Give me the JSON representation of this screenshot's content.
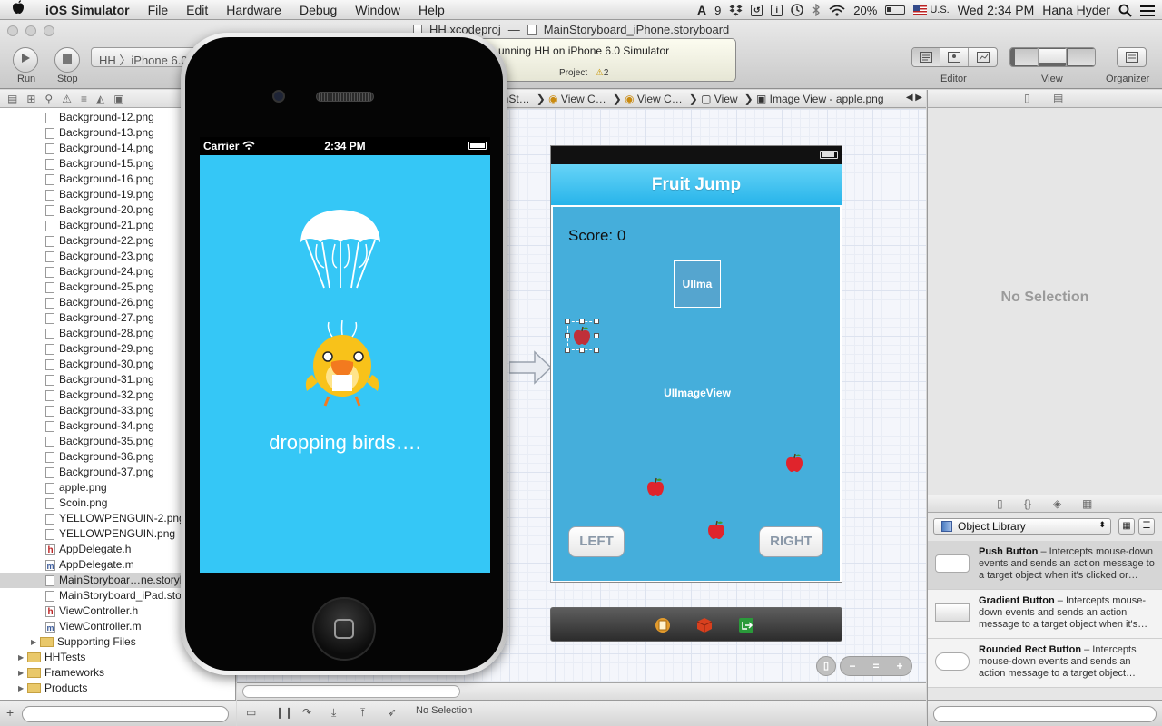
{
  "menubar": {
    "app_name": "iOS Simulator",
    "menus": [
      "File",
      "Edit",
      "Hardware",
      "Debug",
      "Window",
      "Help"
    ],
    "status": {
      "num_badge": "9",
      "battery": "20%",
      "input_source": "U.S.",
      "datetime": "Wed 2:34 PM",
      "user": "Hana Hyder"
    }
  },
  "toolbar": {
    "run_label": "Run",
    "stop_label": "Stop",
    "scheme": "HH 〉iPhone 6.0",
    "project_file": "HH.xcodeproj",
    "title_sep": "—",
    "storyboard_file": "MainStoryboard_iPhone.storyboard",
    "activity_status": "unning HH on iPhone 6.0 Simulator",
    "activity_project": "Project",
    "warning_count": "2",
    "editor_label": "Editor",
    "view_label": "View",
    "organizer_label": "Organizer"
  },
  "navigator": {
    "files": [
      {
        "name": "Background-12.png",
        "kind": "png"
      },
      {
        "name": "Background-13.png",
        "kind": "png"
      },
      {
        "name": "Background-14.png",
        "kind": "png"
      },
      {
        "name": "Background-15.png",
        "kind": "png"
      },
      {
        "name": "Background-16.png",
        "kind": "png"
      },
      {
        "name": "Background-19.png",
        "kind": "png"
      },
      {
        "name": "Background-20.png",
        "kind": "png"
      },
      {
        "name": "Background-21.png",
        "kind": "png"
      },
      {
        "name": "Background-22.png",
        "kind": "png"
      },
      {
        "name": "Background-23.png",
        "kind": "png"
      },
      {
        "name": "Background-24.png",
        "kind": "png"
      },
      {
        "name": "Background-25.png",
        "kind": "png"
      },
      {
        "name": "Background-26.png",
        "kind": "png"
      },
      {
        "name": "Background-27.png",
        "kind": "png"
      },
      {
        "name": "Background-28.png",
        "kind": "png"
      },
      {
        "name": "Background-29.png",
        "kind": "png"
      },
      {
        "name": "Background-30.png",
        "kind": "png"
      },
      {
        "name": "Background-31.png",
        "kind": "png"
      },
      {
        "name": "Background-32.png",
        "kind": "png"
      },
      {
        "name": "Background-33.png",
        "kind": "png"
      },
      {
        "name": "Background-34.png",
        "kind": "png"
      },
      {
        "name": "Background-35.png",
        "kind": "png"
      },
      {
        "name": "Background-36.png",
        "kind": "png"
      },
      {
        "name": "Background-37.png",
        "kind": "png"
      },
      {
        "name": "apple.png",
        "kind": "png"
      },
      {
        "name": "Scoin.png",
        "kind": "png"
      },
      {
        "name": "YELLOWPENGUIN-2.png",
        "kind": "png"
      },
      {
        "name": "YELLOWPENGUIN.png",
        "kind": "png"
      },
      {
        "name": "AppDelegate.h",
        "kind": "h"
      },
      {
        "name": "AppDelegate.m",
        "kind": "m"
      },
      {
        "name": "MainStoryboar…ne.storyb",
        "kind": "sb",
        "selected": true
      },
      {
        "name": "MainStoryboard_iPad.stor",
        "kind": "sb"
      },
      {
        "name": "ViewController.h",
        "kind": "h"
      },
      {
        "name": "ViewController.m",
        "kind": "m"
      }
    ],
    "supporting_files": "Supporting Files",
    "groups": [
      "HHTests",
      "Frameworks",
      "Products"
    ]
  },
  "jumpbar": {
    "crumbs": [
      "inSt…",
      "View C…",
      "View C…",
      "View",
      "Image View - apple.png"
    ]
  },
  "scene": {
    "title": "Fruit Jump",
    "score": "Score: 0",
    "uima_label": "UIIma",
    "imageview_label": "UIImageView",
    "left_button": "LEFT",
    "right_button": "RIGHT"
  },
  "debugbar": {
    "status": "No Selection"
  },
  "utilities": {
    "no_selection": "No Selection",
    "library_select": "Object Library",
    "library_items": [
      {
        "title": "Push Button",
        "desc": " – Intercepts mouse-down events and sends an action message to a target object when it's clicked or…",
        "selected": true
      },
      {
        "title": "Gradient Button",
        "desc": " – Intercepts mouse-down events and sends an action message to a target object when it's…"
      },
      {
        "title": "Rounded Rect Button",
        "desc": " – Intercepts mouse-down events and sends an action message to a target object…"
      }
    ]
  },
  "simulator": {
    "carrier": "Carrier",
    "time": "2:34 PM",
    "message": "dropping birds…."
  },
  "colors": {
    "sim_background": "#35c7f6",
    "scene_view": "#45aedb",
    "scene_nav": "#27b4ea"
  }
}
